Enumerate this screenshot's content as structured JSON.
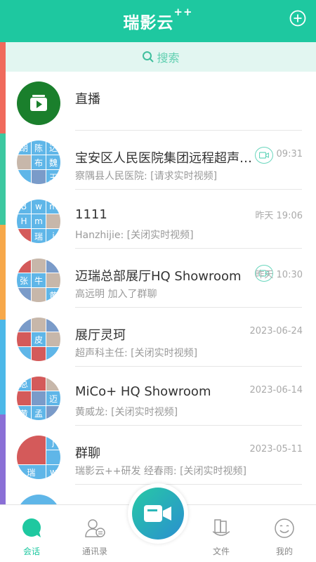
{
  "header": {
    "title": "瑞影云",
    "title_sup": "++"
  },
  "search": {
    "placeholder": "搜索"
  },
  "conversations": [
    {
      "title": "直播",
      "sub": "",
      "time": "",
      "avatar": "live-icon"
    },
    {
      "title": "宝安区人民医院集团远程超声中心",
      "sub": "察隅县人民医院: [请求实时视频]",
      "time": "09:31",
      "video_badge": true,
      "avatar_cells": [
        "胡",
        "陈",
        "达",
        "",
        "布",
        "魏",
        "",
        "",
        "王"
      ]
    },
    {
      "title": "1111",
      "sub": "Hanzhijie: [关闭实时视频]",
      "time": "昨天 19:06",
      "avatar_cells": [
        "B",
        "w",
        "m",
        "H",
        "m",
        "",
        "",
        "瑞",
        "j"
      ]
    },
    {
      "title": "迈瑞总部展厅HQ Showroom",
      "sub": "高远明 加入了群聊",
      "time": "昨天 10:30",
      "video_badge": true,
      "avatar_cells": [
        "",
        "",
        "",
        "张",
        "牛",
        "",
        "",
        "",
        "黄"
      ]
    },
    {
      "title": "展厅灵珂",
      "sub": "超声科主任: [关闭实时视频]",
      "time": "2023-06-24",
      "avatar_cells": [
        "",
        "",
        "",
        "",
        "皮",
        "",
        "",
        "",
        ""
      ]
    },
    {
      "title": "MiCo+ HQ Showroom",
      "sub": "黄威龙: [关闭实时视频]",
      "time": "2023-06-14",
      "avatar_cells": [
        "总",
        "",
        "",
        "",
        "",
        "迈",
        "黄",
        "孟",
        ""
      ]
    },
    {
      "title": "群聊",
      "sub": "瑞影云++研发 经春雨: [关闭实时视频]",
      "time": "2023-05-11",
      "avatar_cells": [
        "",
        "",
        "j",
        "",
        "瑞",
        "",
        "",
        "",
        "w"
      ]
    }
  ],
  "tabs": [
    {
      "label": "会话",
      "icon": "chat-bubble-icon",
      "active": true
    },
    {
      "label": "通讯录",
      "icon": "contacts-icon",
      "active": false
    },
    {
      "label": "文件",
      "icon": "files-icon",
      "active": false
    },
    {
      "label": "我的",
      "icon": "profile-smile-icon",
      "active": false
    }
  ],
  "colors": {
    "accent": "#1ec8a0",
    "avatar_blue": "#5fb6e8",
    "live_green": "#1a7f2c"
  }
}
